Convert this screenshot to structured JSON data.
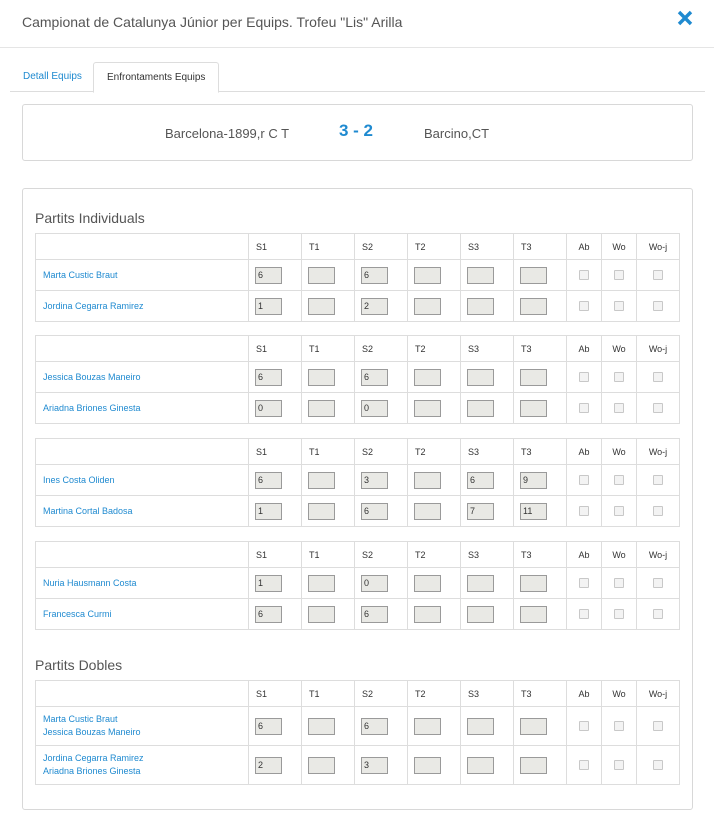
{
  "modal": {
    "title": "Campionat de Catalunya Júnior per Equips. Trofeu \"Lis\" Arilla"
  },
  "tabs": [
    {
      "label": "Detall Equips",
      "active": false
    },
    {
      "label": "Enfrontaments Equips",
      "active": true
    }
  ],
  "summary": {
    "team_a": "Barcelona-1899,r C T",
    "score": "3 - 2",
    "team_b": "Barcino,CT"
  },
  "columns": [
    "S1",
    "T1",
    "S2",
    "T2",
    "S3",
    "T3",
    "Ab",
    "Wo",
    "Wo-j"
  ],
  "sections": {
    "individuals": "Partits Individuals",
    "doubles": "Partits Dobles"
  },
  "individual_matches": [
    {
      "players": [
        {
          "name": "Marta Custic Braut",
          "scores": [
            "6",
            "",
            "6",
            "",
            "",
            ""
          ]
        },
        {
          "name": "Jordina Cegarra Ramirez",
          "scores": [
            "1",
            "",
            "2",
            "",
            "",
            ""
          ]
        }
      ]
    },
    {
      "players": [
        {
          "name": "Jessica Bouzas Maneiro",
          "scores": [
            "6",
            "",
            "6",
            "",
            "",
            ""
          ]
        },
        {
          "name": "Ariadna Briones Ginesta",
          "scores": [
            "0",
            "",
            "0",
            "",
            "",
            ""
          ]
        }
      ]
    },
    {
      "players": [
        {
          "name": "Ines Costa Oliden",
          "scores": [
            "6",
            "",
            "3",
            "",
            "6",
            "9"
          ]
        },
        {
          "name": "Martina Cortal Badosa",
          "scores": [
            "1",
            "",
            "6",
            "",
            "7",
            "11"
          ]
        }
      ]
    },
    {
      "players": [
        {
          "name": "Nuria Hausmann Costa",
          "scores": [
            "1",
            "",
            "0",
            "",
            "",
            ""
          ]
        },
        {
          "name": "Francesca Curmi",
          "scores": [
            "6",
            "",
            "6",
            "",
            "",
            ""
          ]
        }
      ]
    }
  ],
  "doubles_matches": [
    {
      "pairs": [
        {
          "names": [
            "Marta Custic Braut",
            "Jessica Bouzas Maneiro"
          ],
          "scores": [
            "6",
            "",
            "6",
            "",
            "",
            ""
          ]
        },
        {
          "names": [
            "Jordina Cegarra Ramirez",
            "Ariadna Briones Ginesta"
          ],
          "scores": [
            "2",
            "",
            "3",
            "",
            "",
            ""
          ]
        }
      ]
    }
  ],
  "colors": {
    "link": "#1f8ad0",
    "score": "#1f8ad0",
    "close": "#1f8ad0",
    "border": "#dddddd"
  },
  "icons": {
    "close": "close-icon"
  }
}
